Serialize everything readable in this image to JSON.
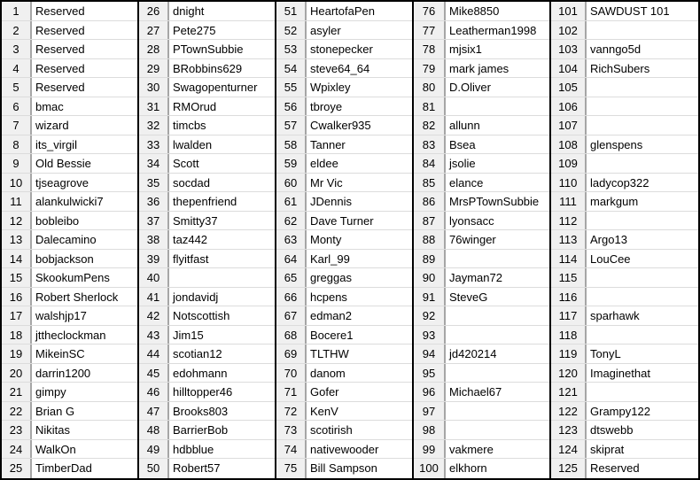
{
  "sheet": {
    "groups": [
      {
        "rows": [
          {
            "num": "1",
            "name": "Reserved"
          },
          {
            "num": "2",
            "name": "Reserved"
          },
          {
            "num": "3",
            "name": "Reserved"
          },
          {
            "num": "4",
            "name": "Reserved"
          },
          {
            "num": "5",
            "name": "Reserved"
          },
          {
            "num": "6",
            "name": "bmac"
          },
          {
            "num": "7",
            "name": "wizard"
          },
          {
            "num": "8",
            "name": "its_virgil"
          },
          {
            "num": "9",
            "name": "Old Bessie"
          },
          {
            "num": "10",
            "name": "tjseagrove"
          },
          {
            "num": "11",
            "name": "alankulwicki7"
          },
          {
            "num": "12",
            "name": "bobleibo"
          },
          {
            "num": "13",
            "name": "Dalecamino"
          },
          {
            "num": "14",
            "name": "bobjackson"
          },
          {
            "num": "15",
            "name": "SkookumPens"
          },
          {
            "num": "16",
            "name": "Robert Sherlock"
          },
          {
            "num": "17",
            "name": "walshjp17"
          },
          {
            "num": "18",
            "name": "jttheclockman"
          },
          {
            "num": "19",
            "name": "MikeinSC"
          },
          {
            "num": "20",
            "name": "darrin1200"
          },
          {
            "num": "21",
            "name": "gimpy"
          },
          {
            "num": "22",
            "name": "Brian G"
          },
          {
            "num": "23",
            "name": "Nikitas"
          },
          {
            "num": "24",
            "name": "WalkOn"
          },
          {
            "num": "25",
            "name": "TimberDad"
          }
        ]
      },
      {
        "rows": [
          {
            "num": "26",
            "name": "dnight"
          },
          {
            "num": "27",
            "name": "Pete275"
          },
          {
            "num": "28",
            "name": "PTownSubbie"
          },
          {
            "num": "29",
            "name": "BRobbins629"
          },
          {
            "num": "30",
            "name": "Swagopenturner"
          },
          {
            "num": "31",
            "name": "RMOrud"
          },
          {
            "num": "32",
            "name": "timcbs"
          },
          {
            "num": "33",
            "name": "lwalden"
          },
          {
            "num": "34",
            "name": "Scott"
          },
          {
            "num": "35",
            "name": "socdad"
          },
          {
            "num": "36",
            "name": "thepenfriend"
          },
          {
            "num": "37",
            "name": "Smitty37"
          },
          {
            "num": "38",
            "name": "taz442"
          },
          {
            "num": "39",
            "name": "flyitfast"
          },
          {
            "num": "40",
            "name": ""
          },
          {
            "num": "41",
            "name": "jondavidj"
          },
          {
            "num": "42",
            "name": "Notscottish"
          },
          {
            "num": "43",
            "name": "Jim15"
          },
          {
            "num": "44",
            "name": "scotian12"
          },
          {
            "num": "45",
            "name": "edohmann"
          },
          {
            "num": "46",
            "name": "hilltopper46"
          },
          {
            "num": "47",
            "name": "Brooks803"
          },
          {
            "num": "48",
            "name": "BarrierBob"
          },
          {
            "num": "49",
            "name": "hdbblue"
          },
          {
            "num": "50",
            "name": "Robert57"
          }
        ]
      },
      {
        "rows": [
          {
            "num": "51",
            "name": "HeartofaPen"
          },
          {
            "num": "52",
            "name": "asyler"
          },
          {
            "num": "53",
            "name": "stonepecker"
          },
          {
            "num": "54",
            "name": "steve64_64"
          },
          {
            "num": "55",
            "name": "Wpixley"
          },
          {
            "num": "56",
            "name": "tbroye"
          },
          {
            "num": "57",
            "name": "Cwalker935"
          },
          {
            "num": "58",
            "name": "Tanner"
          },
          {
            "num": "59",
            "name": "eldee"
          },
          {
            "num": "60",
            "name": "Mr Vic"
          },
          {
            "num": "61",
            "name": "JDennis"
          },
          {
            "num": "62",
            "name": "Dave Turner"
          },
          {
            "num": "63",
            "name": "Monty"
          },
          {
            "num": "64",
            "name": "Karl_99"
          },
          {
            "num": "65",
            "name": "greggas"
          },
          {
            "num": "66",
            "name": "hcpens"
          },
          {
            "num": "67",
            "name": "edman2"
          },
          {
            "num": "68",
            "name": "Bocere1"
          },
          {
            "num": "69",
            "name": "TLTHW"
          },
          {
            "num": "70",
            "name": "danom"
          },
          {
            "num": "71",
            "name": "Gofer"
          },
          {
            "num": "72",
            "name": "KenV"
          },
          {
            "num": "73",
            "name": "scotirish"
          },
          {
            "num": "74",
            "name": "nativewooder"
          },
          {
            "num": "75",
            "name": "Bill Sampson"
          }
        ]
      },
      {
        "rows": [
          {
            "num": "76",
            "name": "Mike8850"
          },
          {
            "num": "77",
            "name": "Leatherman1998"
          },
          {
            "num": "78",
            "name": "mjsix1"
          },
          {
            "num": "79",
            "name": "mark james"
          },
          {
            "num": "80",
            "name": "D.Oliver"
          },
          {
            "num": "81",
            "name": ""
          },
          {
            "num": "82",
            "name": "allunn"
          },
          {
            "num": "83",
            "name": "Bsea"
          },
          {
            "num": "84",
            "name": "jsolie"
          },
          {
            "num": "85",
            "name": "elance"
          },
          {
            "num": "86",
            "name": "MrsPTownSubbie"
          },
          {
            "num": "87",
            "name": "lyonsacc"
          },
          {
            "num": "88",
            "name": "76winger"
          },
          {
            "num": "89",
            "name": ""
          },
          {
            "num": "90",
            "name": "Jayman72"
          },
          {
            "num": "91",
            "name": "SteveG"
          },
          {
            "num": "92",
            "name": ""
          },
          {
            "num": "93",
            "name": ""
          },
          {
            "num": "94",
            "name": "jd420214"
          },
          {
            "num": "95",
            "name": ""
          },
          {
            "num": "96",
            "name": "Michael67"
          },
          {
            "num": "97",
            "name": ""
          },
          {
            "num": "98",
            "name": ""
          },
          {
            "num": "99",
            "name": "vakmere"
          },
          {
            "num": "100",
            "name": "elkhorn"
          }
        ]
      },
      {
        "rows": [
          {
            "num": "101",
            "name": "SAWDUST 101"
          },
          {
            "num": "102",
            "name": ""
          },
          {
            "num": "103",
            "name": "vanngo5d"
          },
          {
            "num": "104",
            "name": "RichSubers"
          },
          {
            "num": "105",
            "name": ""
          },
          {
            "num": "106",
            "name": ""
          },
          {
            "num": "107",
            "name": ""
          },
          {
            "num": "108",
            "name": "glenspens"
          },
          {
            "num": "109",
            "name": ""
          },
          {
            "num": "110",
            "name": "ladycop322"
          },
          {
            "num": "111",
            "name": "markgum"
          },
          {
            "num": "112",
            "name": ""
          },
          {
            "num": "113",
            "name": "Argo13"
          },
          {
            "num": "114",
            "name": "LouCee"
          },
          {
            "num": "115",
            "name": ""
          },
          {
            "num": "116",
            "name": ""
          },
          {
            "num": "117",
            "name": "sparhawk"
          },
          {
            "num": "118",
            "name": ""
          },
          {
            "num": "119",
            "name": "TonyL"
          },
          {
            "num": "120",
            "name": "Imaginethat"
          },
          {
            "num": "121",
            "name": ""
          },
          {
            "num": "122",
            "name": "Grampy122"
          },
          {
            "num": "123",
            "name": "dtswebb"
          },
          {
            "num": "124",
            "name": "skiprat"
          },
          {
            "num": "125",
            "name": "Reserved"
          }
        ]
      }
    ]
  }
}
